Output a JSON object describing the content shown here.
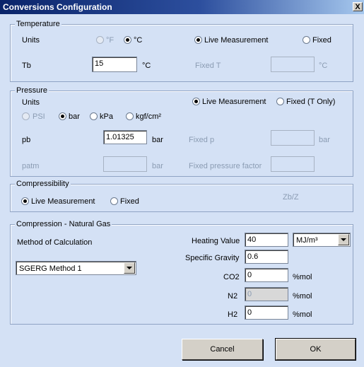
{
  "window": {
    "title": "Conversions Configuration",
    "close_glyph": "X"
  },
  "temperature": {
    "group_label": "Temperature",
    "units_label": "Units",
    "unit_f": "°F",
    "unit_c": "°C",
    "selected_unit": "°C",
    "mode_live": "Live Measurement",
    "mode_fixed": "Fixed",
    "selected_mode": "Live Measurement",
    "tb_label": "Tb",
    "tb_value": "15",
    "tb_unit": "°C",
    "fixed_t_label": "Fixed T",
    "fixed_t_value": "",
    "fixed_t_unit": "°C"
  },
  "pressure": {
    "group_label": "Pressure",
    "units_label": "Units",
    "mode_live": "Live Measurement",
    "mode_fixed": "Fixed (T Only)",
    "selected_mode": "Live Measurement",
    "unit_psi": "PSI",
    "unit_bar": "bar",
    "unit_kpa": "kPa",
    "unit_kgf": "kgf/cm²",
    "selected_unit": "bar",
    "pb_label": "pb",
    "pb_value": "1.01325",
    "pb_unit": "bar",
    "fixed_p_label": "Fixed p",
    "fixed_p_value": "",
    "fixed_p_unit": "bar",
    "patm_label": "patm",
    "patm_value": "",
    "patm_unit": "bar",
    "fixed_factor_label": "Fixed pressure factor",
    "fixed_factor_value": ""
  },
  "compressibility": {
    "group_label": "Compressibility",
    "mode_live": "Live Measurement",
    "mode_fixed": "Fixed",
    "selected_mode": "Live Measurement",
    "zb_z_label": "Zb/Z"
  },
  "compression": {
    "group_label": "Compression - Natural Gas",
    "method_label": "Method of Calculation",
    "method_value": "SGERG Method 1",
    "heating_value_label": "Heating Value",
    "heating_value": "40",
    "heating_unit": "MJ/m³",
    "specific_gravity_label": "Specific Gravity",
    "specific_gravity": "0.6",
    "co2_label": "CO2",
    "co2_value": "0",
    "co2_unit": "%mol",
    "n2_label": "N2",
    "n2_value": "0",
    "n2_unit": "%mol",
    "h2_label": "H2",
    "h2_value": "0",
    "h2_unit": "%mol"
  },
  "buttons": {
    "cancel": "Cancel",
    "ok": "OK"
  }
}
